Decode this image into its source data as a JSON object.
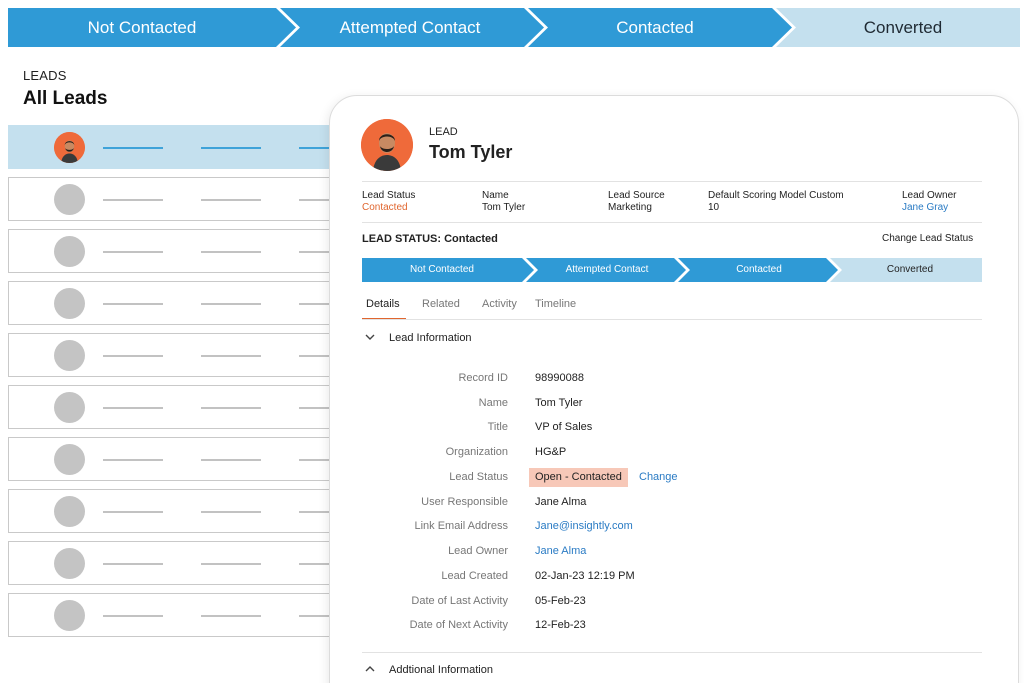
{
  "pipeline": {
    "stages": [
      "Not Contacted",
      "Attempted Contact",
      "Contacted",
      "Converted"
    ]
  },
  "leads": {
    "eyebrow": "LEADS",
    "title": "All Leads",
    "row_count": 10
  },
  "lead": {
    "eyebrow": "LEAD",
    "name": "Tom Tyler",
    "meta": {
      "status_label": "Lead Status",
      "status_value": "Contacted",
      "name_label": "Name",
      "name_value": "Tom Tyler",
      "source_label": "Lead Source",
      "source_value": "Marketing",
      "score_label": "Default Scoring Model Custom",
      "score_value": "10",
      "owner_label": "Lead Owner",
      "owner_value": "Jane Gray"
    },
    "status_title": "LEAD STATUS: Contacted",
    "change_status": "Change Lead Status",
    "pipeline": [
      "Not Contacted",
      "Attempted Contact",
      "Contacted",
      "Converted"
    ],
    "tabs": [
      "Details",
      "Related",
      "Activity",
      "Timeline"
    ],
    "section_info": "Lead Information",
    "section_additional": "Addtional Information",
    "fields": {
      "record_id_label": "Record ID",
      "record_id": "98990088",
      "name_label": "Name",
      "name": "Tom Tyler",
      "title_label": "Title",
      "title": "VP of Sales",
      "org_label": "Organization",
      "org": "HG&P",
      "status_label": "Lead Status",
      "status": "Open - Contacted",
      "change": "Change",
      "user_label": "User Responsible",
      "user": "Jane Alma",
      "email_label": "Link Email Address",
      "email": "Jane@insightly.com",
      "owner_label": "Lead Owner",
      "owner": "Jane Alma",
      "created_label": "Lead Created",
      "created": "02-Jan-23 12:19 PM",
      "last_label": "Date of Last Activity",
      "last": "05-Feb-23",
      "next_label": "Date of Next Activity",
      "next": "12-Feb-23"
    }
  },
  "colors": {
    "stage_blue": "#2f9ad6",
    "stage_light": "#c4e0ee",
    "accent_orange": "#e0662f",
    "link_blue": "#2a7bc4",
    "status_pill": "#f7c8b8"
  },
  "icons": {
    "collapse": "chevron-down-icon",
    "expand": "chevron-up-icon"
  }
}
